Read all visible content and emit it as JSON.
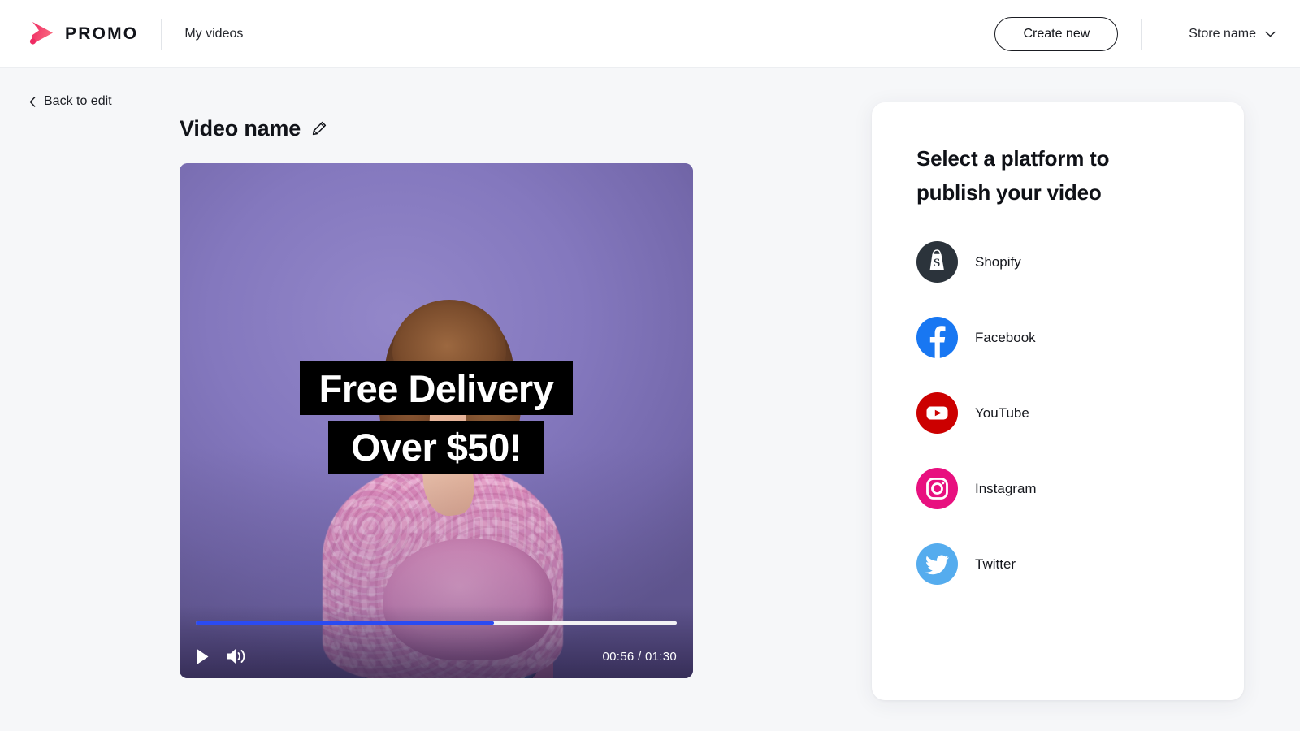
{
  "header": {
    "logo_icon": "promo-play-logo",
    "brand": "PROMO",
    "nav_label": "My videos",
    "create_label": "Create new",
    "store_label": "Store name",
    "chevron_icon": "chevron-down-icon"
  },
  "back": {
    "icon": "chevron-left-icon",
    "label": "Back to edit"
  },
  "video": {
    "title": "Video name",
    "edit_icon": "pencil-icon",
    "caption_line1": "Free Delivery",
    "caption_line2": "Over $50!",
    "play_icon": "play-icon",
    "volume_icon": "volume-icon",
    "current_time": "00:56",
    "duration": "01:30",
    "time_display": "00:56 / 01:30",
    "progress_percent": 62,
    "progress_color": "#2b4bf2"
  },
  "panel": {
    "title": "Select a platform to publish your video",
    "platforms": [
      {
        "name": "Shopify",
        "icon": "shopify-icon",
        "color": "#2b333b"
      },
      {
        "name": "Facebook",
        "icon": "facebook-icon",
        "color": "#1877f2"
      },
      {
        "name": "YouTube",
        "icon": "youtube-icon",
        "color": "#cc0000"
      },
      {
        "name": "Instagram",
        "icon": "instagram-icon",
        "color": "#e8107f"
      },
      {
        "name": "Twitter",
        "icon": "twitter-icon",
        "color": "#55acee"
      }
    ]
  },
  "theme": {
    "background": "#f6f7f9",
    "brand_pink": "#ef3e6d",
    "text_dark": "#111319"
  }
}
